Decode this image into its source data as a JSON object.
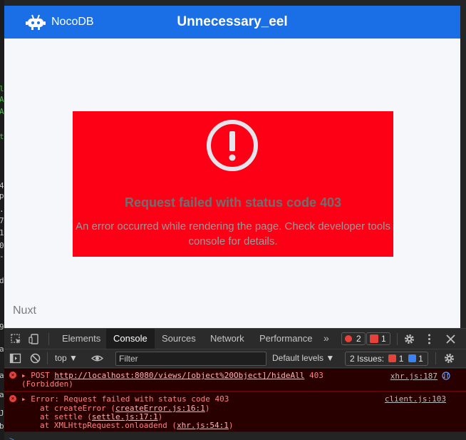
{
  "terminal": {
    "chars": [
      {
        "t": "l",
        "c": "g"
      },
      {
        "t": "A",
        "c": "g"
      },
      {
        "t": "A",
        "c": "g"
      },
      {
        "t": "t",
        "c": "g"
      },
      {
        "t": "4",
        "c": "w"
      },
      {
        "t": "p",
        "c": "w"
      },
      {
        "t": ".",
        "c": "w"
      },
      {
        "t": "7",
        "c": "w"
      },
      {
        "t": "1",
        "c": "w"
      },
      {
        "t": "0",
        "c": "w"
      },
      {
        "t": "-",
        "c": "w"
      },
      {
        "t": "d",
        "c": "w"
      },
      {
        "t": "9",
        "c": "w"
      },
      {
        "t": "a",
        "c": "w"
      },
      {
        "t": "a",
        "c": "w"
      },
      {
        "t": "a",
        "c": "w"
      },
      {
        "t": "J",
        "c": "w"
      },
      {
        "t": "b",
        "c": "w"
      }
    ]
  },
  "app": {
    "brand": "NocoDB",
    "project_title": "Unnecessary_eel"
  },
  "error": {
    "title": "Request failed with status code 403",
    "description": "An error occurred while rendering the page. Check developer tools console for details."
  },
  "footer": {
    "framework": "Nuxt"
  },
  "devtools": {
    "tabs": [
      "Elements",
      "Console",
      "Sources",
      "Network",
      "Performance"
    ],
    "active_tab": "Console",
    "more_tabs_glyph": "»",
    "error_count": "2",
    "warning_count": "1",
    "context": "top ▼",
    "filter_placeholder": "Filter",
    "levels": "Default levels ▼",
    "issues_label": "2 Issues:",
    "issues_error_count": "1",
    "issues_info_count": "1",
    "messages": [
      {
        "method": "POST",
        "url": "http://localhost:8080/views/[object%20Object]/hideAll",
        "status": "403",
        "status_text": "(Forbidden)",
        "source": "xhr.js:187"
      },
      {
        "text": "Error: Request failed with status code 403",
        "source": "client.js:103",
        "stack": [
          {
            "prefix": "at createError (",
            "link": "createError.js:16:1",
            "suffix": ")"
          },
          {
            "prefix": "at settle (",
            "link": "settle.js:17:1",
            "suffix": ")"
          },
          {
            "prefix": "at XMLHttpRequest.onloadend (",
            "link": "xhr.js:54:1",
            "suffix": ")"
          }
        ]
      }
    ],
    "prompt": ">"
  },
  "colors": {
    "header_blue": "#1a6fe6",
    "error_red": "#fe0015",
    "console_error_bg": "#290000"
  }
}
